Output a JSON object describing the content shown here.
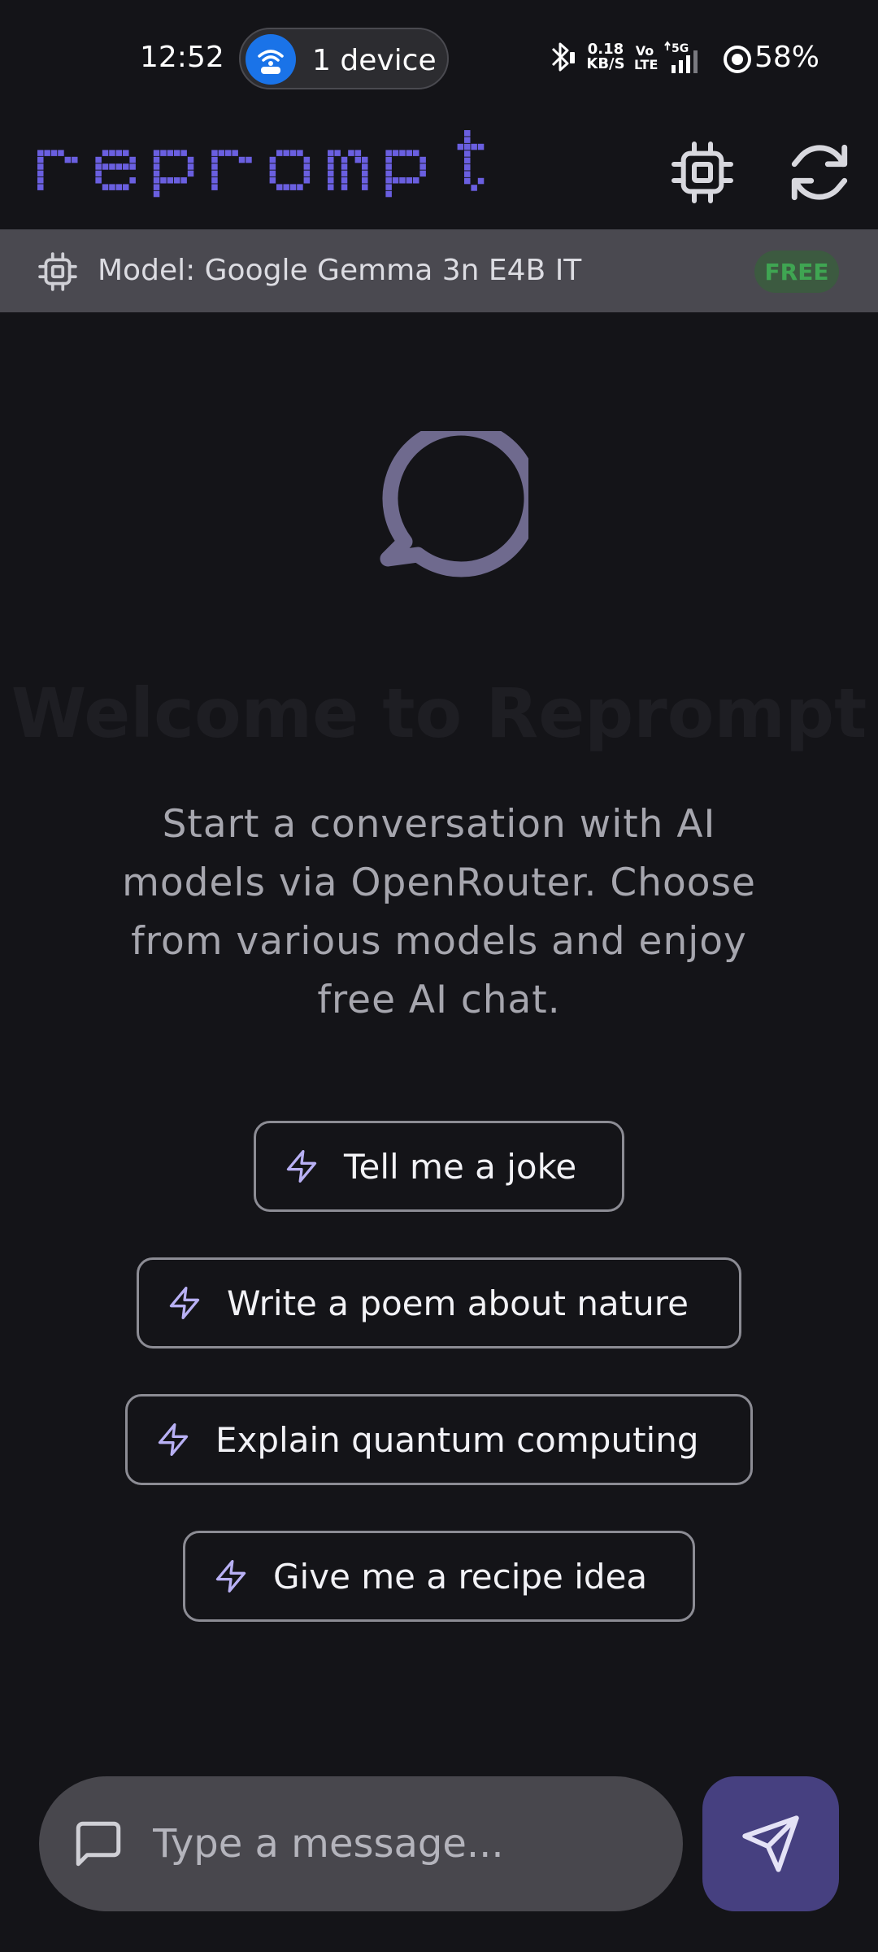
{
  "status_bar": {
    "time": "12:52",
    "hotspot_label": "1 device",
    "network_speed_value": "0.18",
    "network_speed_unit": "KB/S",
    "volte_top": "Vo",
    "volte_bottom": "LTE",
    "network_type": "5G",
    "battery": "58%",
    "icons": [
      "wifi-hotspot-icon",
      "bluetooth-icon",
      "signal-icon",
      "battery-saver-icon"
    ]
  },
  "header": {
    "logo_text": "reprompt",
    "actions": [
      {
        "name": "model-select",
        "icon": "cpu-chip-icon"
      },
      {
        "name": "refresh",
        "icon": "refresh-icon"
      }
    ]
  },
  "model_bar": {
    "label": "Model: Google Gemma 3n E4B IT",
    "badge": "FREE",
    "icon": "cpu-chip-icon"
  },
  "welcome": {
    "icon": "chat-bubble-icon",
    "title": "Welcome to Reprompt",
    "subtitle": "Start a conversation with AI models via OpenRouter. Choose from various models and enjoy free AI chat."
  },
  "suggestions": [
    {
      "label": "Tell me a joke",
      "icon": "lightning-icon"
    },
    {
      "label": "Write a poem about nature",
      "icon": "lightning-icon"
    },
    {
      "label": "Explain quantum computing",
      "icon": "lightning-icon"
    },
    {
      "label": "Give me a recipe idea",
      "icon": "lightning-icon"
    }
  ],
  "composer": {
    "placeholder": "Type a message...",
    "value": "",
    "icon": "message-square-icon",
    "send_icon": "send-icon"
  },
  "colors": {
    "background": "#141418",
    "accent": "#6a5fe0",
    "model_bar": "#4a4950",
    "free_badge_text": "#3fa552",
    "send_button": "#464080",
    "muted_icon": "#6f6a8e"
  }
}
